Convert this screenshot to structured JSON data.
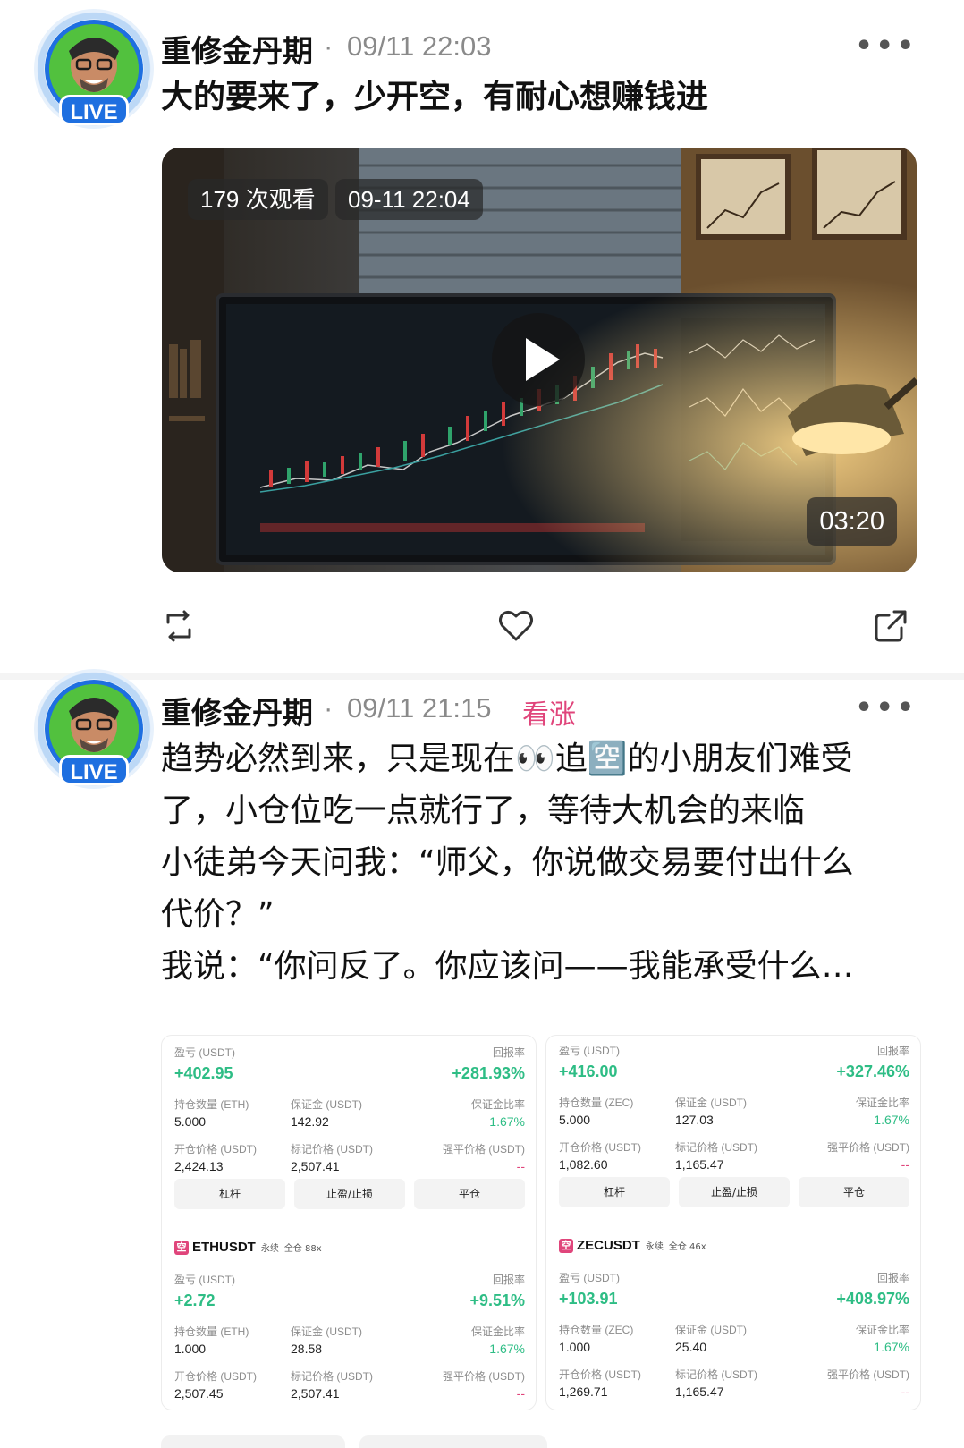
{
  "posts": [
    {
      "author": "重修金丹期",
      "time": "09/11 22:03",
      "text": "大的要来了，少开空，有耐心想赚钱进",
      "live_badge": "LIVE",
      "video": {
        "views": "179 次观看",
        "date": "09-11 22:04",
        "duration": "03:20"
      },
      "actions": {
        "repost_icon": "repost-icon",
        "like_icon": "heart-icon",
        "share_icon": "share-icon"
      }
    },
    {
      "author": "重修金丹期",
      "time": "09/11 21:15",
      "sentiment": "看涨",
      "live_badge": "LIVE",
      "text_lines": [
        "趋势必然到来，只是现在👀追🈳的小朋友们难受",
        "了，小仓位吃一点就行了，等待大机会的来临",
        "小徒弟今天问我：“师父，你说做交易要付出什么",
        "代价？”",
        "我说：“你问反了。你应该问——我能承受什么…"
      ]
    }
  ],
  "positions": {
    "labels": {
      "pnl": "盈亏 (USDT)",
      "roi": "回报率",
      "qty_eth": "持仓数量 (ETH)",
      "qty_zec": "持仓数量 (ZEC)",
      "margin": "保证金 (USDT)",
      "margin_ratio": "保证金比率",
      "open_price": "开仓价格 (USDT)",
      "mark_price": "标记价格 (USDT)",
      "liq_price": "强平价格 (USDT)",
      "btn_leverage": "杠杆",
      "btn_tpsl": "止盈/止损",
      "btn_close": "平仓",
      "perp": "永续",
      "kong": "空"
    },
    "left_top": {
      "pnl": "+402.95",
      "roi": "+281.93%",
      "qty": "5.000",
      "margin": "142.92",
      "margin_ratio": "1.67%",
      "open": "2,424.13",
      "mark": "2,507.41",
      "liq": "--"
    },
    "left_bottom": {
      "symbol": "ETHUSDT",
      "mode": "全仓 88x",
      "pnl": "+2.72",
      "roi": "+9.51%",
      "qty": "1.000",
      "margin": "28.58",
      "margin_ratio": "1.67%",
      "open": "2,507.45",
      "mark": "2,507.41",
      "liq": "--"
    },
    "right_top": {
      "pnl": "+416.00",
      "roi": "+327.46%",
      "qty": "5.000",
      "margin": "127.03",
      "margin_ratio": "1.67%",
      "open": "1,082.60",
      "mark": "1,165.47",
      "liq": "--"
    },
    "right_bottom": {
      "symbol": "ZECUSDT",
      "mode": "全仓 46x",
      "pnl": "+103.91",
      "roi": "+408.97%",
      "qty": "1.000",
      "margin": "25.40",
      "margin_ratio": "1.67%",
      "open": "1,269.71",
      "mark": "1,165.47",
      "liq": "--"
    }
  },
  "colors": {
    "green": "#2ebd85",
    "pink": "#e0457b",
    "blue": "#1e6fe0"
  }
}
